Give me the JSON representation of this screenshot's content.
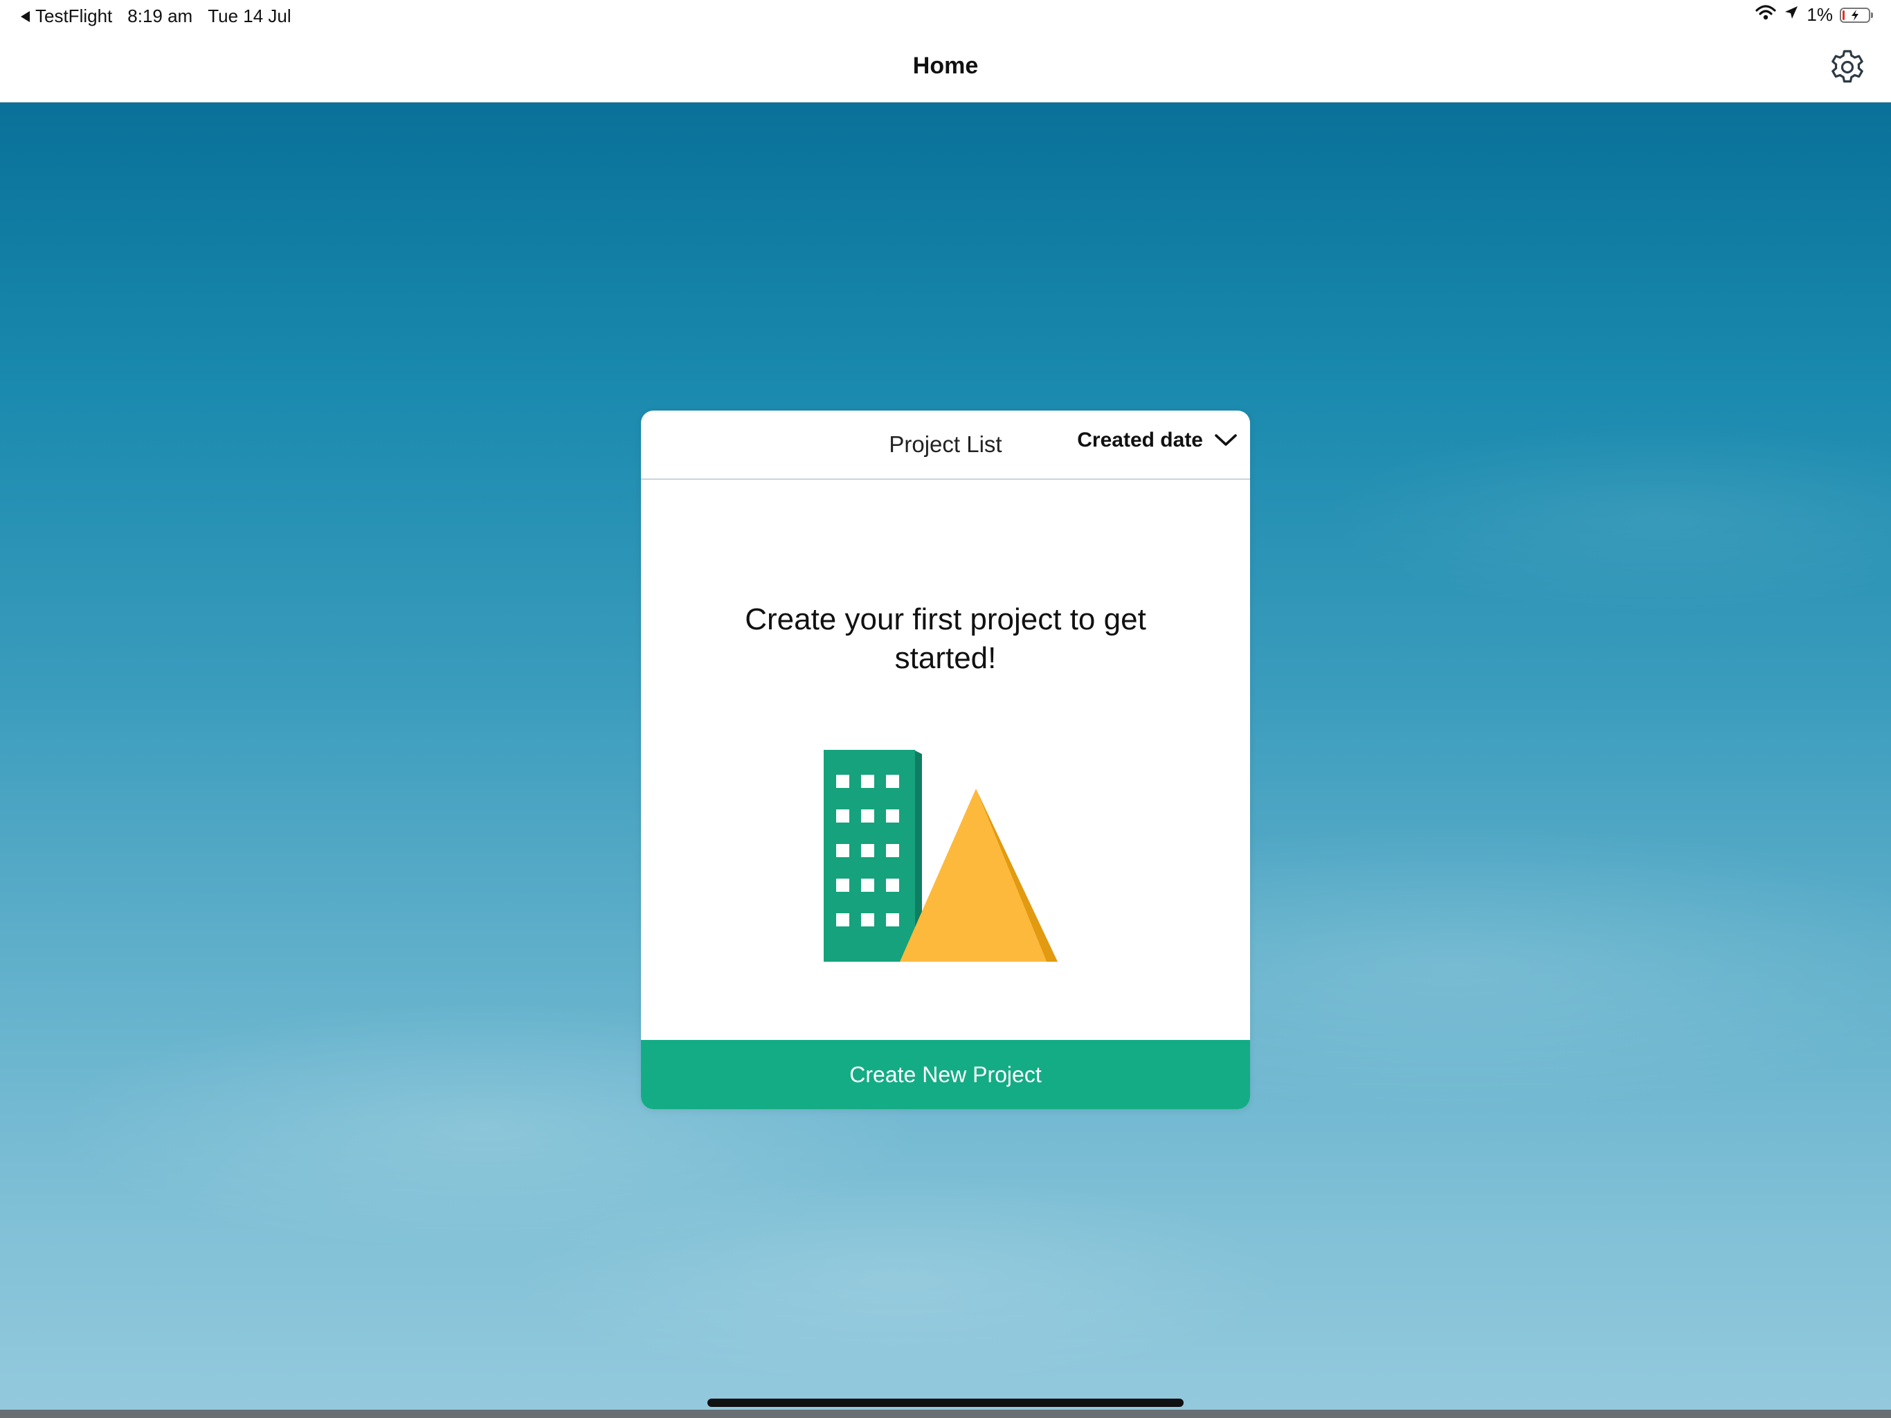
{
  "status_bar": {
    "back_app": "TestFlight",
    "time": "8:19 am",
    "date": "Tue 14 Jul",
    "battery_percent": "1%",
    "battery_level": 0.01,
    "icons": [
      "wifi-icon",
      "location-arrow-icon",
      "battery-charging-icon"
    ]
  },
  "nav": {
    "title": "Home",
    "settings_icon": "gear-icon"
  },
  "project_card": {
    "title": "Project List",
    "sort_label": "Created date",
    "sort_icon": "chevron-down-icon",
    "empty_message": "Create your first project to get started!",
    "illustration": "building-and-pyramid-illustration",
    "create_button_label": "Create New Project"
  },
  "colors": {
    "accent_green": "#14ac84",
    "building_green": "#16a27c",
    "pyramid_yellow": "#fdb93c",
    "pyramid_shade": "#e29a10",
    "sky_top": "#0a7199",
    "sky_bottom": "#94c9dd"
  }
}
